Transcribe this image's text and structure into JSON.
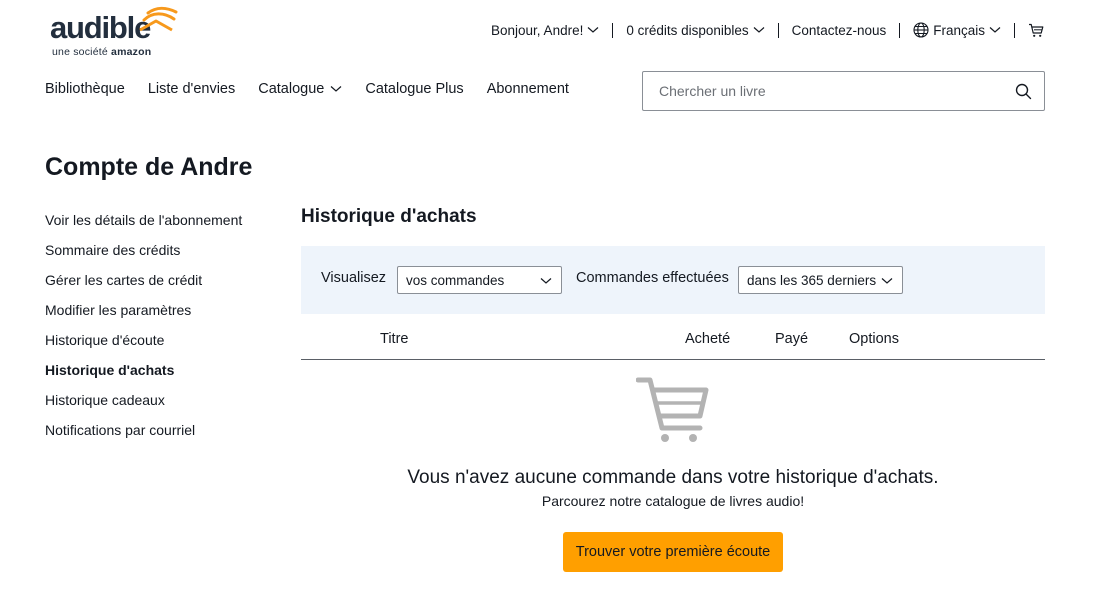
{
  "brand": {
    "name": "audible",
    "tagline_prefix": "une société",
    "tagline_parent": "amazon",
    "accent_color": "#ff9f00",
    "logo_icon": "signal-waves-icon"
  },
  "topbar": {
    "greeting": "Bonjour, Andre!",
    "credits": "0 crédits disponibles",
    "contact": "Contactez-nous",
    "language": "Français",
    "language_icon": "globe-icon",
    "cart_icon": "cart-icon"
  },
  "nav": {
    "items": [
      {
        "label": "Bibliothèque"
      },
      {
        "label": "Liste d'envies"
      },
      {
        "label": "Catalogue"
      },
      {
        "label": "Catalogue Plus"
      },
      {
        "label": "Abonnement"
      }
    ]
  },
  "search": {
    "placeholder": "Chercher un livre",
    "value": "",
    "icon": "search-icon"
  },
  "page": {
    "title": "Compte de Andre"
  },
  "sidebar": {
    "items": [
      {
        "label": "Voir les détails de l'abonnement"
      },
      {
        "label": "Sommaire des crédits"
      },
      {
        "label": "Gérer les cartes de crédit"
      },
      {
        "label": "Modifier les paramètres"
      },
      {
        "label": "Historique d'écoute"
      },
      {
        "label": "Historique d'achats",
        "active": true
      },
      {
        "label": "Historique cadeaux"
      },
      {
        "label": "Notifications par courriel"
      }
    ]
  },
  "history": {
    "title": "Historique d'achats",
    "filter_view_label": "Visualisez",
    "filter_view_value": "vos commandes",
    "filter_period_label": "Commandes effectuées",
    "filter_period_value": "dans les 365 derniers",
    "filter_bg": "#eef4fb",
    "columns": [
      "Titre",
      "Acheté",
      "Payé",
      "Options"
    ],
    "empty_icon": "empty-cart-icon",
    "empty_message": "Vous n'avez aucune commande dans votre historique d'achats.",
    "empty_sub": "Parcourez notre catalogue de livres audio!",
    "cta_label": "Trouver votre première écoute"
  }
}
